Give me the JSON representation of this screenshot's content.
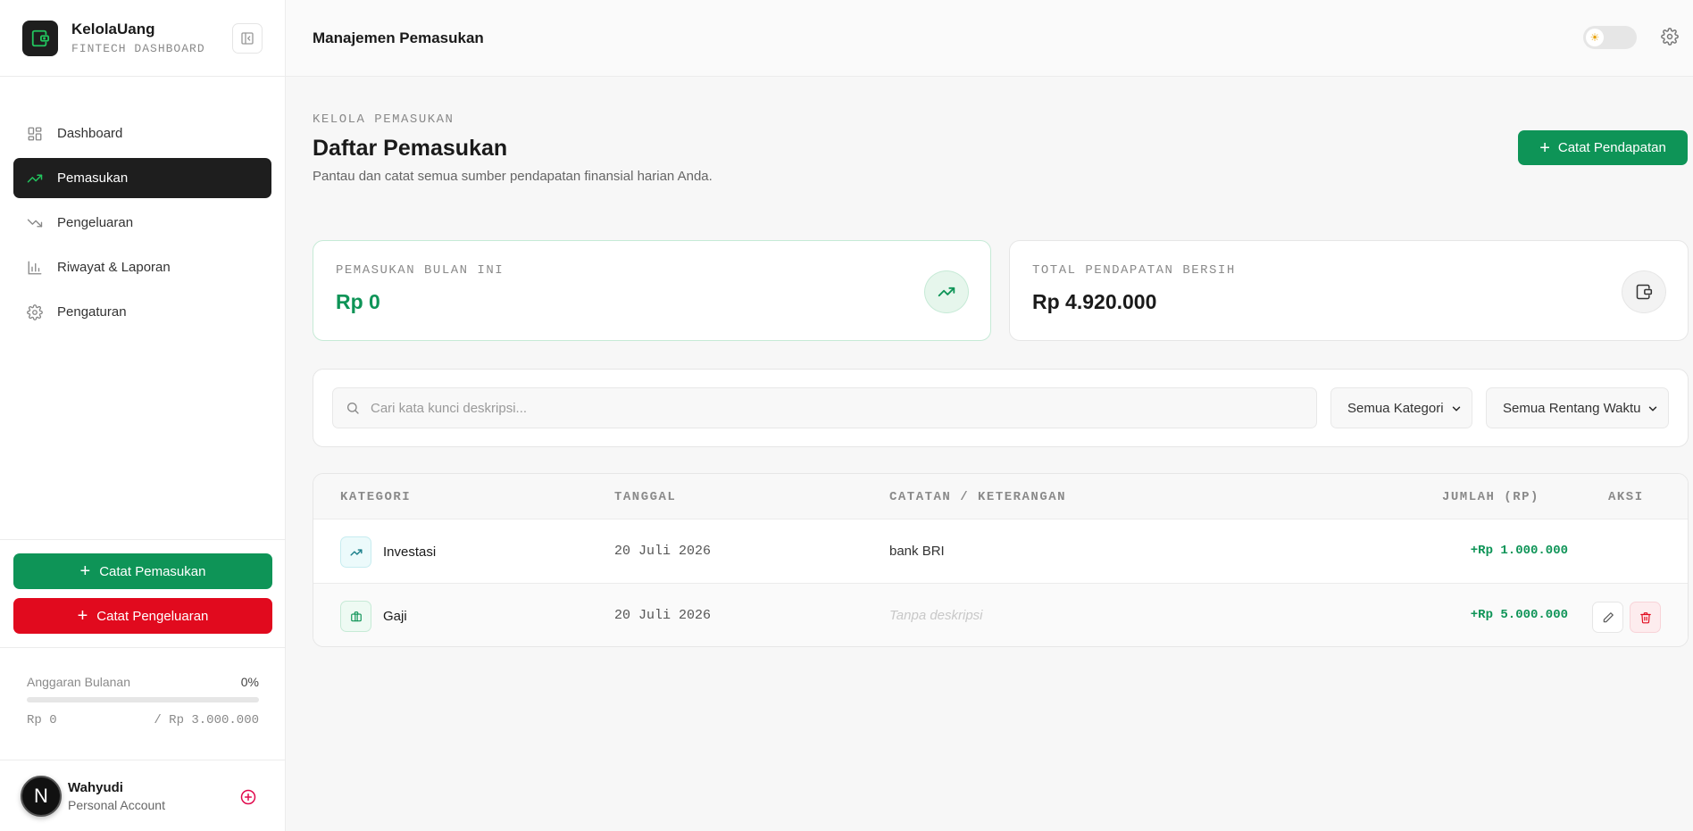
{
  "brand": {
    "name": "KelolaUang",
    "subtitle": "FINTECH DASHBOARD"
  },
  "sidebar": {
    "items": [
      {
        "label": "Dashboard",
        "icon": "grid-icon",
        "active": false
      },
      {
        "label": "Pemasukan",
        "icon": "trending-up-icon",
        "active": true
      },
      {
        "label": "Pengeluaran",
        "icon": "trending-down-icon",
        "active": false
      },
      {
        "label": "Riwayat & Laporan",
        "icon": "bar-chart-icon",
        "active": false
      },
      {
        "label": "Pengaturan",
        "icon": "gear-icon",
        "active": false
      }
    ],
    "actions": {
      "income_label": "Catat Pemasukan",
      "expense_label": "Catat Pengeluaran"
    },
    "budget": {
      "label": "Anggaran Bulanan",
      "percent": "0%",
      "progress": 0,
      "spent": "Rp 0",
      "limit": "/ Rp 3.000.000"
    },
    "user": {
      "name": "Wahyudi",
      "role": "Personal Account",
      "initial": "N"
    }
  },
  "header": {
    "title": "Manajemen Pemasukan"
  },
  "page": {
    "eyebrow": "KELOLA PEMASUKAN",
    "title": "Daftar Pemasukan",
    "subtitle": "Pantau dan catat semua sumber pendapatan finansial harian Anda.",
    "primary_button": "Catat Pendapatan"
  },
  "stats": [
    {
      "label": "PEMASUKAN BULAN INI",
      "value": "Rp 0"
    },
    {
      "label": "TOTAL PENDAPATAN BERSIH",
      "value": "Rp 4.920.000"
    }
  ],
  "filters": {
    "search_placeholder": "Cari kata kunci deskripsi...",
    "category": "Semua Kategori",
    "time_range": "Semua Rentang Waktu"
  },
  "table": {
    "headers": [
      "KATEGORI",
      "TANGGAL",
      "CATATAN / KETERANGAN",
      "JUMLAH (RP)",
      "AKSI"
    ],
    "rows": [
      {
        "category": "Investasi",
        "date": "20 Juli 2026",
        "note": "bank BRI",
        "amount": "+Rp 1.000.000"
      },
      {
        "category": "Gaji",
        "date": "20 Juli 2026",
        "note": "Tanpa deskripsi",
        "amount": "+Rp 5.000.000"
      }
    ]
  },
  "colors": {
    "accent": "#0e9457",
    "danger": "#e10a1e",
    "dark": "#1e1e1e"
  }
}
